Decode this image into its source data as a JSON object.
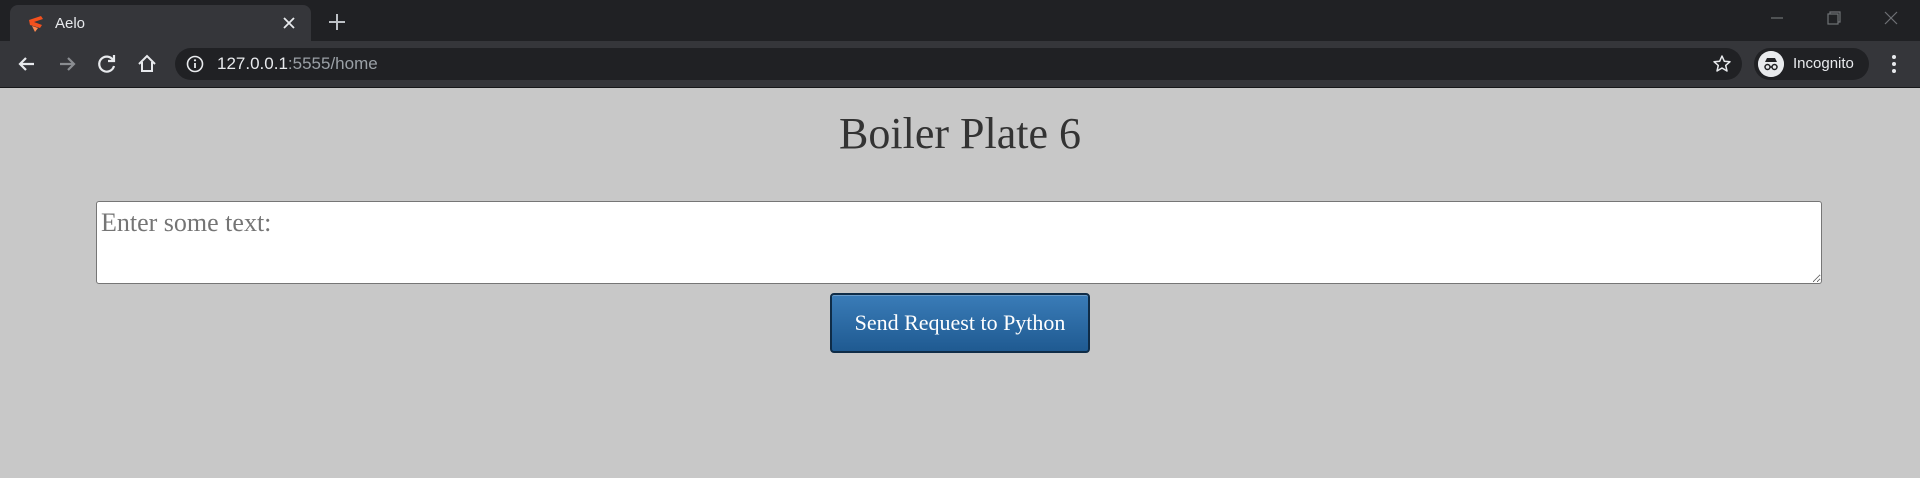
{
  "browser": {
    "tab": {
      "title": "Aelo",
      "favicon": "app-logo-icon"
    },
    "address": {
      "host": "127.0.0.1",
      "rest": ":5555/home"
    },
    "profile": {
      "label": "Incognito"
    }
  },
  "page": {
    "title": "Boiler Plate 6",
    "textarea": {
      "placeholder": "Enter some text:",
      "value": ""
    },
    "send_button": {
      "label": "Send Request to Python",
      "color": "#2b6ca6"
    },
    "background": "#c8c8c8"
  }
}
